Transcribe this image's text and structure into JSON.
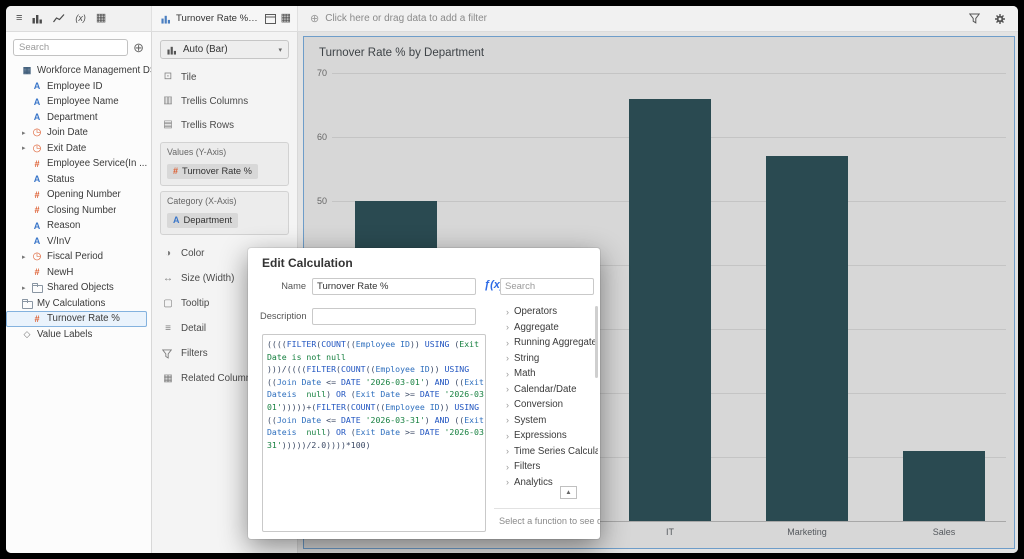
{
  "colors": {
    "accent": "#3a76c9",
    "measure": "#dd5b2d",
    "selection": "#6e9dc9",
    "fx": "#2e6be6"
  },
  "icons": {
    "menu": "≡",
    "function_x": "(x)",
    "grid": "▦",
    "add_data": "⊕",
    "add_filter": "⊕",
    "dropdown_caret": "▾",
    "expand_caret": "▸",
    "chevron_right": "›",
    "scroll_up": "▲",
    "attribute": "A",
    "measure": "#",
    "clock": "◷",
    "dataset": "▦",
    "tag": "◇",
    "tile": "⊡",
    "trellis_columns": "▥",
    "trellis_rows": "▤",
    "color": "◑",
    "size": "↔",
    "tooltip": "▢",
    "detail": "≡",
    "related": "▦"
  },
  "toolbar": {
    "filter_hint": "Click here or drag data to add a filter"
  },
  "data_panel": {
    "search_placeholder": "Search",
    "items": [
      {
        "icon": "dataset",
        "label": "Workforce Management DS",
        "indent": 0
      },
      {
        "icon": "attribute",
        "label": "Employee ID",
        "indent": 1
      },
      {
        "icon": "attribute",
        "label": "Employee Name",
        "indent": 1
      },
      {
        "icon": "attribute",
        "label": "Department",
        "indent": 1
      },
      {
        "icon": "clock",
        "label": "Join Date",
        "indent": 1,
        "expandable": true
      },
      {
        "icon": "clock",
        "label": "Exit Date",
        "indent": 1,
        "expandable": true
      },
      {
        "icon": "measure",
        "label": "Employee Service(In ...",
        "indent": 1
      },
      {
        "icon": "attribute",
        "label": "Status",
        "indent": 1
      },
      {
        "icon": "measure",
        "label": "Opening Number",
        "indent": 1
      },
      {
        "icon": "measure",
        "label": "Closing Number",
        "indent": 1
      },
      {
        "icon": "attribute",
        "label": "Reason",
        "indent": 1
      },
      {
        "icon": "attribute",
        "label": "V/InV",
        "indent": 1
      },
      {
        "icon": "clock",
        "label": "Fiscal Period",
        "indent": 1,
        "expandable": true
      },
      {
        "icon": "measure",
        "label": "NewH",
        "indent": 1
      },
      {
        "icon": "folder",
        "label": "Shared Objects",
        "indent": 1,
        "expandable": true
      },
      {
        "icon": "folder",
        "label": "My Calculations",
        "indent": 0
      },
      {
        "icon": "measure",
        "label": "Turnover Rate %",
        "indent": 1,
        "selected": true
      },
      {
        "icon": "tag",
        "label": "Value Labels",
        "indent": 0
      }
    ]
  },
  "viz_panel": {
    "tab_title": "Turnover Rate % by...",
    "chart_type_selector": "Auto (Bar)",
    "grammar_rows": [
      {
        "icon": "tile",
        "label": "Tile"
      },
      {
        "icon": "trellis_columns",
        "label": "Trellis Columns"
      },
      {
        "icon": "trellis_rows",
        "label": "Trellis Rows"
      }
    ],
    "values_axis": {
      "label": "Values (Y-Axis)",
      "pill_label": "Turnover Rate %"
    },
    "category_axis": {
      "label": "Category (X-Axis)",
      "pill_label": "Department"
    },
    "sections": [
      {
        "icon": "color",
        "label": "Color"
      },
      {
        "icon": "size",
        "label": "Size (Width)"
      },
      {
        "icon": "tooltip",
        "label": "Tooltip"
      },
      {
        "icon": "detail",
        "label": "Detail"
      },
      {
        "icon": "funnel",
        "label": "Filters"
      },
      {
        "icon": "related",
        "label": "Related Columns"
      }
    ]
  },
  "chart_data": {
    "type": "bar",
    "title": "Turnover Rate % by Department",
    "categories": [
      "",
      "",
      "IT",
      "Marketing",
      "Sales"
    ],
    "values": [
      50,
      null,
      66,
      57,
      11
    ],
    "ylim": [
      0,
      70
    ],
    "yticks": [
      0,
      10,
      20,
      30,
      40,
      50,
      60,
      70
    ],
    "grid": true,
    "legend": "none",
    "bar_color": "#2a4a51",
    "plot_bg": "#d7d7d7"
  },
  "modal": {
    "title": "Edit Calculation",
    "name_label": "Name",
    "name_value": "Turnover Rate %",
    "fx_label": "ƒ(x)",
    "search_placeholder": "Search",
    "description_label": "Description",
    "description_value": "",
    "function_categories": [
      "Operators",
      "Aggregate",
      "Running Aggregate",
      "String",
      "Math",
      "Calendar/Date",
      "Conversion",
      "System",
      "Expressions",
      "Time Series Calculation",
      "Filters",
      "Analytics"
    ],
    "hint": "Select a function to see de",
    "formula_lines": [
      [
        [
          "p",
          "(((("
        ],
        [
          "k",
          "FILTER"
        ],
        [
          "p",
          "("
        ],
        [
          "k",
          "COUNT"
        ],
        [
          "p",
          "(("
        ],
        [
          "f",
          "Employee ID"
        ],
        [
          "p",
          ")) "
        ],
        [
          "k",
          "USING"
        ],
        [
          "p",
          " ("
        ],
        [
          "s",
          "Exit"
        ]
      ],
      [
        [
          "s",
          "Date is not null"
        ]
      ],
      [
        [
          "p",
          ")))/(((("
        ],
        [
          "k",
          "FILTER"
        ],
        [
          "p",
          "("
        ],
        [
          "k",
          "COUNT"
        ],
        [
          "p",
          "(("
        ],
        [
          "f",
          "Employee ID"
        ],
        [
          "p",
          ")) "
        ],
        [
          "k",
          "USING"
        ]
      ],
      [
        [
          "p",
          "(("
        ],
        [
          "f",
          "Join Date"
        ],
        [
          "p",
          " <= "
        ],
        [
          "k",
          "DATE"
        ],
        [
          "p",
          " "
        ],
        [
          "s",
          "'2026-03-01'"
        ],
        [
          "p",
          ") "
        ],
        [
          "k",
          "AND"
        ],
        [
          "p",
          " (("
        ],
        [
          "f",
          "Exit"
        ]
      ],
      [
        [
          "f",
          "Dateis"
        ],
        [
          "p",
          "  "
        ],
        [
          "s",
          "null"
        ],
        [
          "p",
          ") "
        ],
        [
          "k",
          "OR"
        ],
        [
          "p",
          " ("
        ],
        [
          "f",
          "Exit Date"
        ],
        [
          "p",
          " >= "
        ],
        [
          "k",
          "DATE"
        ],
        [
          "s",
          " '2026-03-"
        ]
      ],
      [
        [
          "s",
          "01'"
        ],
        [
          "p",
          ")))))+("
        ],
        [
          "k",
          "FILTER"
        ],
        [
          "p",
          "("
        ],
        [
          "k",
          "COUNT"
        ],
        [
          "p",
          "(("
        ],
        [
          "f",
          "Employee ID"
        ],
        [
          "p",
          ")) "
        ],
        [
          "k",
          "USING"
        ]
      ],
      [
        [
          "p",
          "(("
        ],
        [
          "f",
          "Join Date"
        ],
        [
          "p",
          " <= "
        ],
        [
          "k",
          "DATE"
        ],
        [
          "p",
          " "
        ],
        [
          "s",
          "'2026-03-31'"
        ],
        [
          "p",
          ") "
        ],
        [
          "k",
          "AND"
        ],
        [
          "p",
          " (("
        ],
        [
          "f",
          "Exit"
        ]
      ],
      [
        [
          "f",
          "Dateis"
        ],
        [
          "p",
          "  "
        ],
        [
          "s",
          "null"
        ],
        [
          "p",
          ") "
        ],
        [
          "k",
          "OR"
        ],
        [
          "p",
          " ("
        ],
        [
          "f",
          "Exit Date"
        ],
        [
          "p",
          " >= "
        ],
        [
          "k",
          "DATE"
        ],
        [
          "s",
          " '2026-03-"
        ]
      ],
      [
        [
          "s",
          "31'"
        ],
        [
          "p",
          ")))))/2.0))))*100)"
        ]
      ]
    ]
  }
}
